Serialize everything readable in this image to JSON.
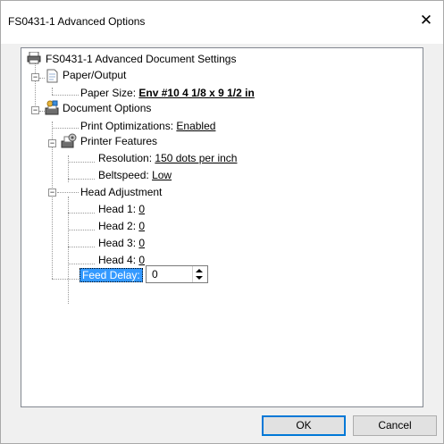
{
  "window": {
    "title": "FS0431-1 Advanced Options",
    "close_glyph": "✕"
  },
  "tree": {
    "root": {
      "label": "FS0431-1 Advanced Document Settings"
    },
    "paper_output": {
      "label": "Paper/Output",
      "paper_size": {
        "label": "Paper Size:",
        "value": "Env #10 4 1/8 x 9 1/2 in"
      }
    },
    "document_options": {
      "label": "Document Options",
      "print_optimizations": {
        "label": "Print Optimizations:",
        "value": "Enabled"
      },
      "printer_features": {
        "label": "Printer Features",
        "resolution": {
          "label": "Resolution:",
          "value": "150 dots per inch"
        },
        "beltspeed": {
          "label": "Beltspeed:",
          "value": "Low"
        }
      },
      "head_adjustment": {
        "label": "Head Adjustment",
        "heads": [
          {
            "label": "Head 1:",
            "value": "0"
          },
          {
            "label": "Head 2:",
            "value": "0"
          },
          {
            "label": "Head 3:",
            "value": "0"
          },
          {
            "label": "Head 4:",
            "value": "0"
          }
        ]
      },
      "feed_delay": {
        "label": "Feed Delay:",
        "value": "0"
      }
    },
    "expander_collapse_glyph": "−"
  },
  "buttons": {
    "ok": "OK",
    "cancel": "Cancel"
  },
  "colors": {
    "selection": "#3399ff",
    "ok_border": "#0078d7"
  }
}
